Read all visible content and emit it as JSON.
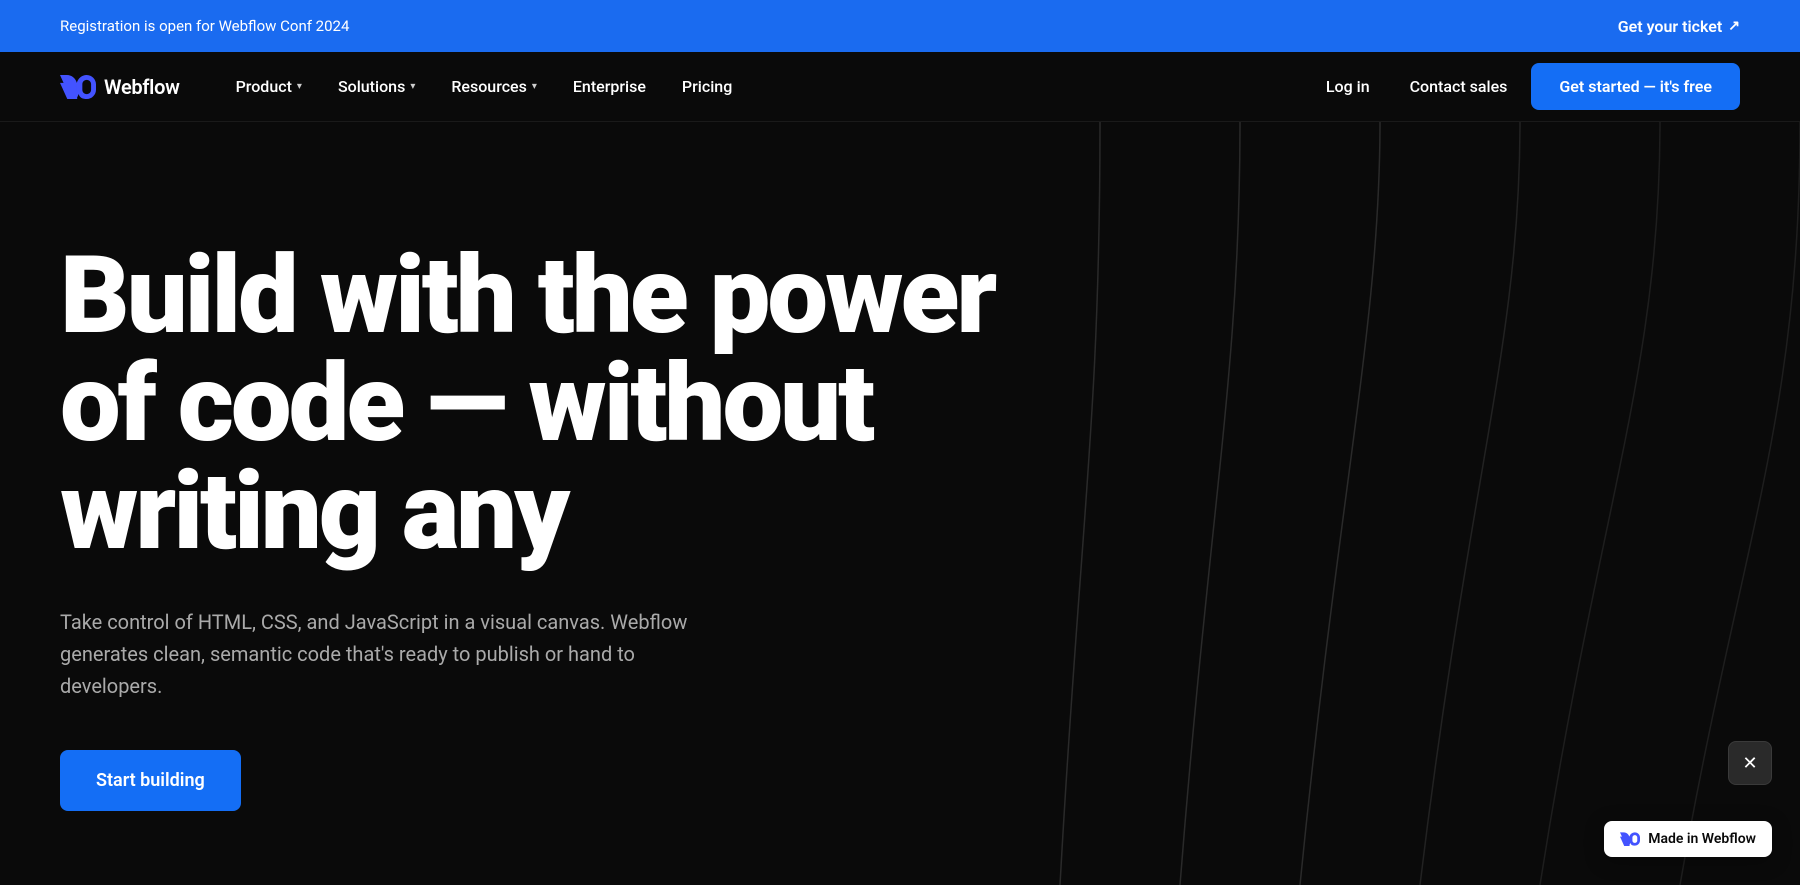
{
  "announcement": {
    "text": "Registration is open for Webflow Conf 2024",
    "link_text": "Get your ticket",
    "external_icon": "↗"
  },
  "navbar": {
    "logo_text": "Webflow",
    "nav_items": [
      {
        "label": "Product",
        "has_dropdown": true
      },
      {
        "label": "Solutions",
        "has_dropdown": true
      },
      {
        "label": "Resources",
        "has_dropdown": true
      },
      {
        "label": "Enterprise",
        "has_dropdown": false
      },
      {
        "label": "Pricing",
        "has_dropdown": false
      }
    ],
    "right_items": [
      {
        "label": "Log in"
      },
      {
        "label": "Contact sales"
      }
    ],
    "cta_label": "Get started — it's free"
  },
  "hero": {
    "title_line1": "Build with the power",
    "title_line2": "of code — without",
    "title_line3": "writing any",
    "subtitle": "Take control of HTML, CSS, and JavaScript in a visual canvas. Webflow generates clean, semantic code that's ready to publish or hand to developers.",
    "cta_label": "Start building"
  },
  "made_in_webflow": {
    "label": "Made in Webflow"
  },
  "corner_button": {
    "icon": "✕"
  }
}
